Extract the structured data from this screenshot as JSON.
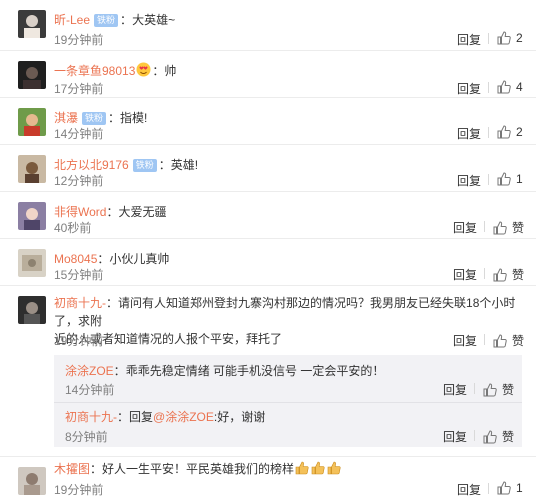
{
  "comments": [
    {
      "user": "昕-Lee",
      "badge": "铁粉",
      "sep": "：",
      "text": "大英雄~",
      "time": "19分钟前",
      "reply": "回复",
      "likes": "2"
    },
    {
      "user": "一条章鱼98013",
      "badge": "",
      "sep": "：",
      "text": "帅",
      "time": "17分钟前",
      "reply": "回复",
      "likes": "4"
    },
    {
      "user": "淇瀑",
      "badge": "铁粉",
      "sep": "：",
      "text": "指模!",
      "time": "14分钟前",
      "reply": "回复",
      "likes": "2"
    },
    {
      "user": "北方以北9176",
      "badge": "铁粉",
      "sep": "：",
      "text": "英雄!",
      "time": "12分钟前",
      "reply": "回复",
      "likes": "1"
    },
    {
      "user": "非得Word",
      "badge": "",
      "sep": "：",
      "text": "大爱无疆",
      "time": "40秒前",
      "reply": "回复",
      "likes": "赞"
    },
    {
      "user": "Mo8045",
      "badge": "",
      "sep": "：",
      "text": "小伙儿真帅",
      "time": "15分钟前",
      "reply": "回复",
      "likes": "赞"
    },
    {
      "user": "初商十九-",
      "badge": "",
      "sep": "：",
      "text_line1": "请问有人知道郑州登封九寨沟村那边的情况吗？我男朋友已经失联18个小时了，求附",
      "text_line2": "近的人或者知道情况的人报个平安，拜托了",
      "time": "19分钟前",
      "reply": "回复",
      "likes": "赞"
    },
    {
      "user": "木攉图",
      "badge": "",
      "sep": "：",
      "text": "好人一生平安！平民英雄我们的榜样",
      "time": "19分钟前",
      "reply": "回复",
      "likes": "1"
    }
  ],
  "sub_replies": [
    {
      "user": "涂涂ZOE",
      "sep": "：",
      "text": "乖乖先稳定情绪 可能手机没信号 一定会平安的！",
      "time": "14分钟前",
      "reply": "回复",
      "likes": "赞"
    },
    {
      "user": "初商十九-",
      "sep": "：",
      "prefix": "回复",
      "mention": "@涂涂ZOE",
      "text": ":好，谢谢",
      "time": "8分钟前",
      "reply": "回复",
      "likes": "赞"
    }
  ]
}
